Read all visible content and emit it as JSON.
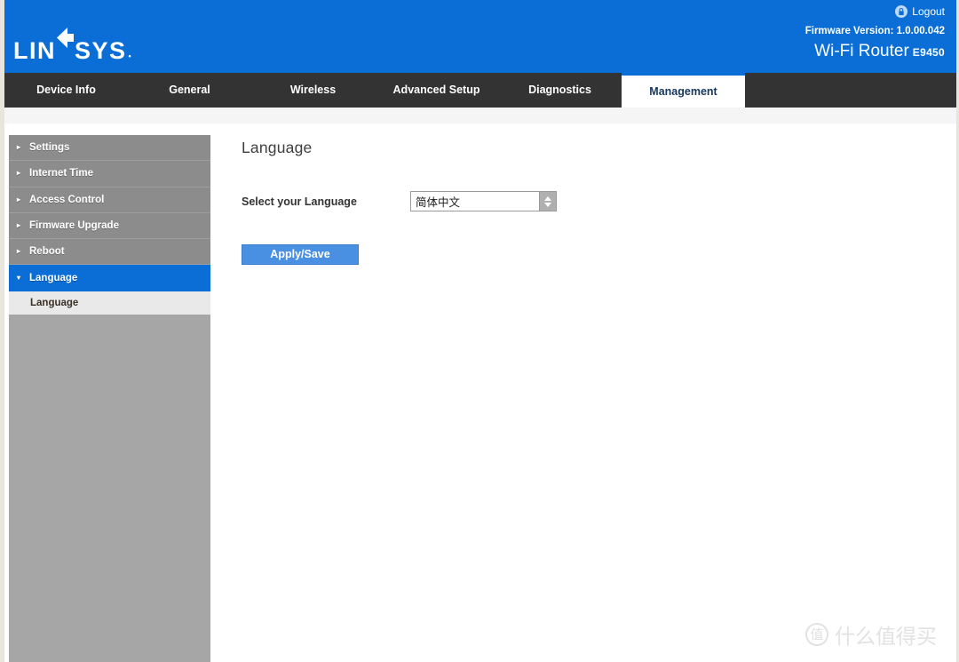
{
  "header": {
    "brand": "LINKSYS",
    "brand_part_1": "LIN",
    "brand_part_2": "SYS",
    "trademark": "·",
    "logout_label": "Logout",
    "logout_icon": "lock-icon",
    "firmware": "Firmware Version: 1.0.00.042",
    "product_name": "Wi-Fi Router",
    "model": "E9450",
    "brand_color": "#0a6ed6"
  },
  "nav": {
    "tabs": [
      {
        "label": "Device Info",
        "active": false
      },
      {
        "label": "General",
        "active": false
      },
      {
        "label": "Wireless",
        "active": false
      },
      {
        "label": "Advanced Setup",
        "active": false
      },
      {
        "label": "Diagnostics",
        "active": false
      },
      {
        "label": "Management",
        "active": true
      }
    ],
    "active_tab": "Management",
    "bar_color": "#333333",
    "active_text_color": "#17365d"
  },
  "sidebar": {
    "items": [
      {
        "label": "Settings",
        "caret": "▸",
        "expanded": false
      },
      {
        "label": "Internet Time",
        "caret": "▸",
        "expanded": false
      },
      {
        "label": "Access Control",
        "caret": "▸",
        "expanded": false
      },
      {
        "label": "Firmware Upgrade",
        "caret": "▸",
        "expanded": false
      },
      {
        "label": "Reboot",
        "caret": "▸",
        "expanded": false
      },
      {
        "label": "Language",
        "caret": "▾",
        "expanded": true
      }
    ],
    "subitems": [
      {
        "label": "Language",
        "parent": "Language",
        "selected": true
      }
    ],
    "item_color": "#8c8c8c",
    "expanded_color": "#0a6ed6",
    "subitem_color": "#e9e9e9"
  },
  "content": {
    "title": "Language",
    "select_label": "Select your Language",
    "select_value": "简体中文",
    "select_options": [
      "简体中文"
    ],
    "apply_label": "Apply/Save",
    "apply_color": "#4a90e2"
  },
  "watermark": {
    "mark": "值",
    "text": "什么值得买"
  }
}
